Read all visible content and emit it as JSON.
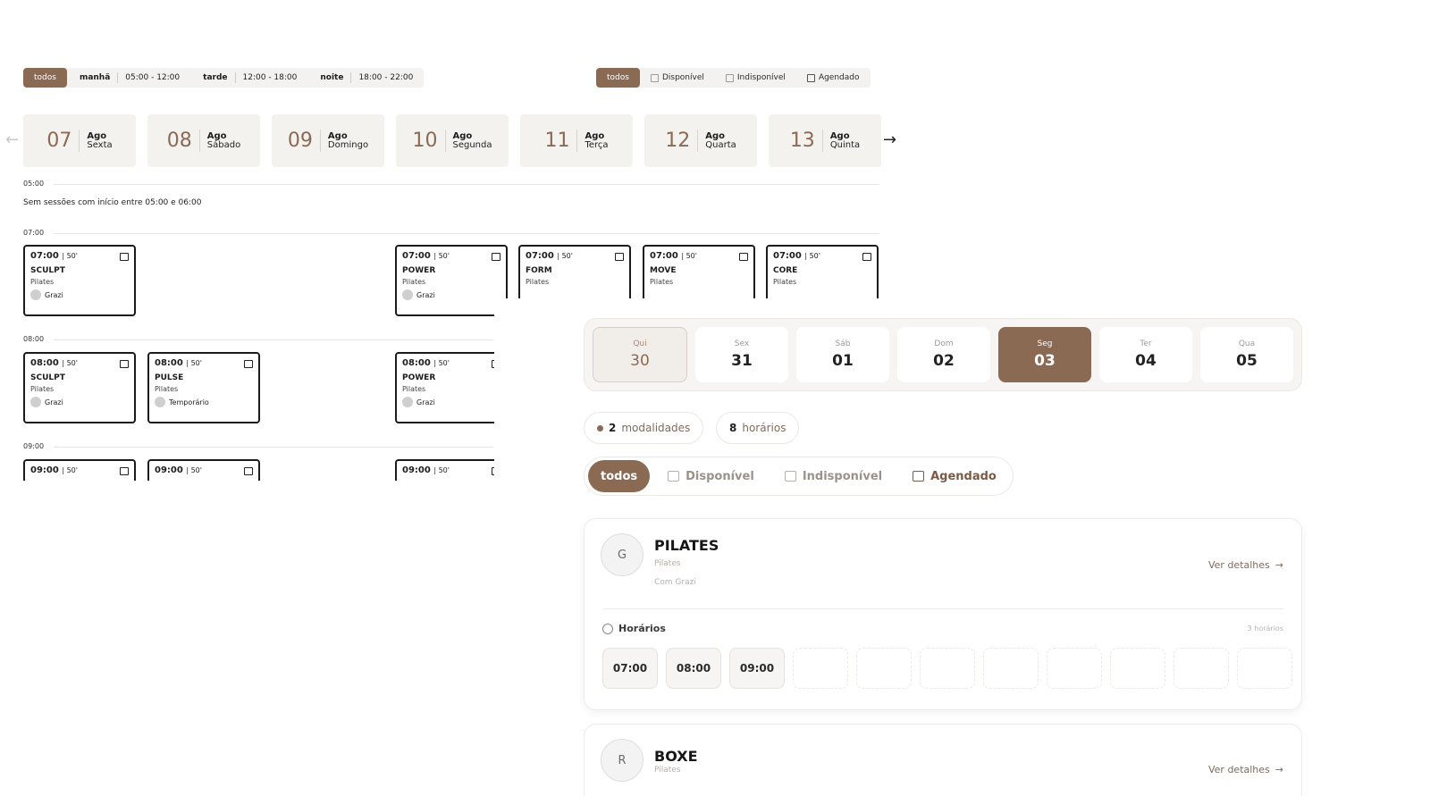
{
  "period_filter": {
    "all_label": "todos",
    "periods": [
      {
        "label": "manhã",
        "range": "05:00 - 12:00"
      },
      {
        "label": "tarde",
        "range": "12:00 - 18:00"
      },
      {
        "label": "noite",
        "range": "18:00 - 22:00"
      }
    ]
  },
  "status_filter_small": {
    "all_label": "todos",
    "items": [
      {
        "label": "Disponível",
        "icon": "calendar-icon"
      },
      {
        "label": "Indisponível",
        "icon": "calendar-blocked-icon"
      },
      {
        "label": "Agendado",
        "icon": "calendar-check-icon"
      }
    ]
  },
  "days": [
    {
      "num": "07",
      "month": "Ago",
      "weekday": "Sexta"
    },
    {
      "num": "08",
      "month": "Ago",
      "weekday": "Sábado"
    },
    {
      "num": "09",
      "month": "Ago",
      "weekday": "Domingo"
    },
    {
      "num": "10",
      "month": "Ago",
      "weekday": "Segunda"
    },
    {
      "num": "11",
      "month": "Ago",
      "weekday": "Terça"
    },
    {
      "num": "12",
      "month": "Ago",
      "weekday": "Quarta"
    },
    {
      "num": "13",
      "month": "Ago",
      "weekday": "Quinta"
    }
  ],
  "schedule": {
    "hour_0500": "05:00",
    "empty_message": "Sem sessões com início entre 05:00 e 06:00",
    "hour_0700": "07:00",
    "hour_0800": "08:00",
    "hour_0900": "09:00",
    "row_0700": [
      {
        "time": "07:00",
        "duration": "50'",
        "name": "SCULPT",
        "modality": "Pilates",
        "instructor": "Grazi"
      },
      {
        "time": "07:00",
        "duration": "50'",
        "name": "POWER",
        "modality": "Pilates",
        "instructor": "Grazi"
      },
      {
        "time": "07:00",
        "duration": "50'",
        "name": "FORM",
        "modality": "Pilates"
      },
      {
        "time": "07:00",
        "duration": "50'",
        "name": "MOVE",
        "modality": "Pilates"
      },
      {
        "time": "07:00",
        "duration": "50'",
        "name": "CORE",
        "modality": "Pilates"
      }
    ],
    "row_0800": [
      {
        "time": "08:00",
        "duration": "50'",
        "name": "SCULPT",
        "modality": "Pilates",
        "instructor": "Grazi"
      },
      {
        "time": "08:00",
        "duration": "50'",
        "name": "PULSE",
        "modality": "Pilates",
        "instructor": "Temporário"
      },
      {
        "time": "08:00",
        "duration": "50'",
        "name": "POWER",
        "modality": "Pilates",
        "instructor": "Grazi"
      }
    ],
    "row_0900": [
      {
        "time": "09:00",
        "duration": "50'"
      },
      {
        "time": "09:00",
        "duration": "50'"
      },
      {
        "time": "09:00",
        "duration": "50'"
      }
    ]
  },
  "week": [
    {
      "name": "Qui",
      "day": "30",
      "state": "today"
    },
    {
      "name": "Sex",
      "day": "31",
      "state": ""
    },
    {
      "name": "Sáb",
      "day": "01",
      "state": ""
    },
    {
      "name": "Dom",
      "day": "02",
      "state": ""
    },
    {
      "name": "Seg",
      "day": "03",
      "state": "selected"
    },
    {
      "name": "Ter",
      "day": "04",
      "state": ""
    },
    {
      "name": "Qua",
      "day": "05",
      "state": ""
    }
  ],
  "stats": {
    "modalities_count": "2",
    "modalities_label": "modalidades",
    "times_count": "8",
    "times_label": "horários"
  },
  "status_filter": {
    "all_label": "todos",
    "available_label": "Disponível",
    "unavailable_label": "Indisponível",
    "scheduled_label": "Agendado"
  },
  "cards": [
    {
      "initial": "G",
      "title": "PILATES",
      "modality": "Pilates",
      "instructor": "Com Grazi",
      "details_label": "Ver detalhes",
      "hours_title": "Horários",
      "hours_count": "3 horários",
      "slots": [
        "07:00",
        "08:00",
        "09:00"
      ]
    },
    {
      "initial": "R",
      "title": "BOXE",
      "modality": "Pilates",
      "details_label": "Ver detalhes"
    }
  ],
  "colors": {
    "accent": "#8b6a54",
    "accent_text": "#7d6b5f"
  }
}
